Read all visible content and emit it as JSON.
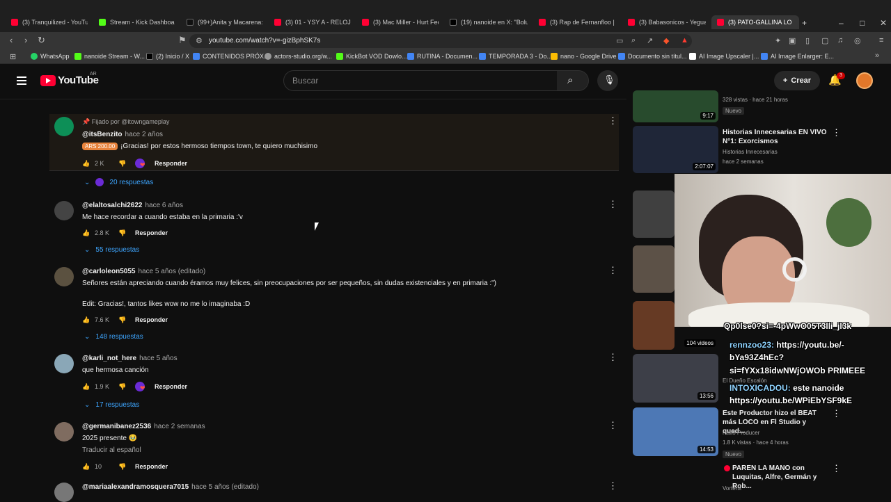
{
  "browser": {
    "tabs": [
      {
        "label": "(3) Tranquilized - YouTube",
        "color": "#ff0033"
      },
      {
        "label": "Stream - Kick Dashboa",
        "color": "#53fc18"
      },
      {
        "label": "(99+)Anita y Macarena: R",
        "color": "#111111"
      },
      {
        "label": "(3) 01 - YSY A - RELOJES R",
        "color": "#ff0033"
      },
      {
        "label": "(3) Mac Miller - Hurt Feelin",
        "color": "#ff0033"
      },
      {
        "label": "(19) nanoide en X: \"Boluda",
        "color": "#000000"
      },
      {
        "label": "(3) Rap de Fernanfloo | Ba",
        "color": "#ff0033"
      },
      {
        "label": "(3) Babasonicos - Yegua -",
        "color": "#ff0033"
      },
      {
        "label": "(3) PATO-GALLINA LO",
        "color": "#ff0033",
        "active": true
      }
    ],
    "url": "youtube.com/watch?v=-gizBphSK7s",
    "bookmarks": [
      {
        "label": "WhatsApp",
        "color": "#25d366"
      },
      {
        "label": "nanoide Stream - W...",
        "color": "#53fc18"
      },
      {
        "label": "(2) Inicio / X",
        "color": "#000000"
      },
      {
        "label": "CONTENIDOS PRÓX...",
        "color": "#4285f4"
      },
      {
        "label": "actors-studio.org/w...",
        "color": "#999999"
      },
      {
        "label": "KickBot VOD Dowlo...",
        "color": "#53fc18"
      },
      {
        "label": "RUTINA - Documen...",
        "color": "#4285f4"
      },
      {
        "label": "TEMPORADA 3 - Do...",
        "color": "#4285f4"
      },
      {
        "label": "nano - Google Drive",
        "color": "#fbbc04"
      },
      {
        "label": "Documento sin títul...",
        "color": "#4285f4"
      },
      {
        "label": "AI Image Upscaler |...",
        "color": "#ffffff"
      },
      {
        "label": "AI Image Enlarger: E...",
        "color": "#4285f4"
      }
    ]
  },
  "youtube": {
    "logo": "YouTube",
    "country": "AR",
    "search_placeholder": "Buscar",
    "create": "Crear",
    "notifications": "3"
  },
  "comments": [
    {
      "pinned": "Fijado por @itowngameplay",
      "author": "@itsBenzito",
      "time": "hace 2 años",
      "badge": "ARS 200.00",
      "text": "¡Gracias! por estos hermoso tiempos town, te quiero muchisimo",
      "likes": "2 K",
      "reply": "Responder",
      "replies": "20 respuestas"
    },
    {
      "author": "@elaltosalchi2622",
      "time": "hace 6 años",
      "text": "Me hace recordar a cuando estaba en la primaria :'v",
      "likes": "2.8 K",
      "reply": "Responder",
      "replies": "55 respuestas"
    },
    {
      "author": "@carloleon5055",
      "time": "hace 5 años (editado)",
      "text": "Señores están apreciando cuando éramos muy felices, sin preocupaciones por ser pequeños, sin dudas existenciales y en primaria :\")",
      "text2": "Edit: Gracias!, tantos likes wow no me lo imaginaba :D",
      "likes": "7.6 K",
      "reply": "Responder",
      "replies": "148 respuestas"
    },
    {
      "author": "@karli_not_here",
      "time": "hace 5 años",
      "text": "que hermosa canción",
      "likes": "1.9 K",
      "reply": "Responder",
      "replies": "17 respuestas"
    },
    {
      "author": "@germanibanez2536",
      "time": "hace 2 semanas",
      "text": "2025 presente 🥹",
      "text2": "Traducir al español",
      "likes": "10",
      "reply": "Responder"
    },
    {
      "author": "@mariaalexandramosquera7015",
      "time": "hace 5 años (editado)"
    }
  ],
  "related": [
    {
      "duration": "9:17",
      "meta1": "328 vistas · hace 21 horas",
      "badge": "Nuevo"
    },
    {
      "title": "Historias Innecesarias EN VIVO N°1: Exorcismos",
      "channel": "Historias Innecesarias",
      "meta1": "hace 2 semanas",
      "duration": "2:07:07"
    },
    {
      "title": "Este Productor hizo el BEAT más LOCO en Fl Studio y qued...",
      "channel": "Naito Producer",
      "meta1": "1.8 K vistas · hace 4 horas",
      "badge": "Nuevo",
      "duration": "14:53"
    },
    {
      "title": "PAREN LA MANO con Luquitas, Alfre, Germán y Rob...",
      "channel": "Vorterix"
    }
  ],
  "related_extra": {
    "playlist_count": "104 videos",
    "duration2": "13:56",
    "channel2": "El Dueño Escalón"
  },
  "stream_chat": [
    {
      "name": "",
      "text": "Qp0lse0?si=-4pWwO05T3lli_jl3k"
    },
    {
      "name": "rennzoo23:",
      "text": "https://youtu.be/-"
    },
    {
      "name": "",
      "text": "bYa93Z4hEc?"
    },
    {
      "name": "",
      "text": "si=fYXx18idwNWjOWOb PRIMEEE"
    },
    {
      "name": "INTOXICADOU:",
      "text": "este nanoide"
    },
    {
      "name": "",
      "text": "https://youtu.be/WPiEbYSF9kE"
    }
  ]
}
